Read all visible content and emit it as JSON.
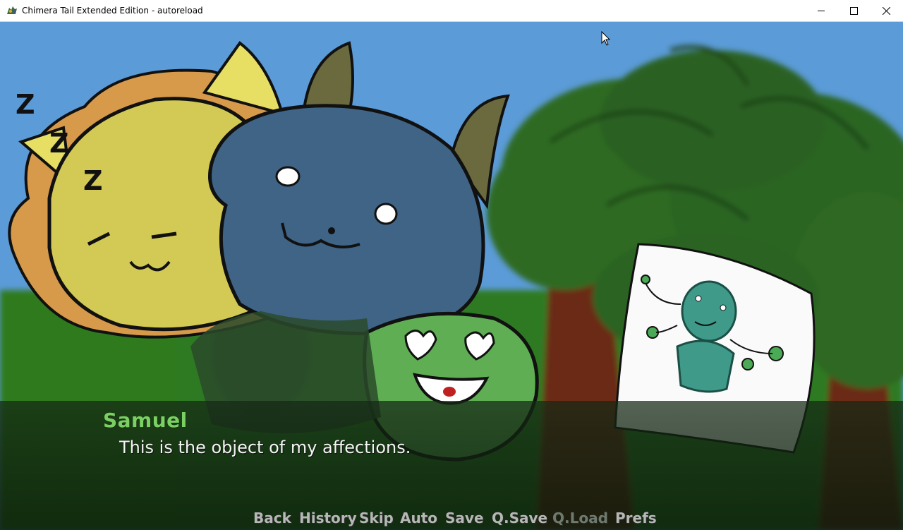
{
  "window": {
    "title": "Chimera Tail Extended Edition - autoreload",
    "minimize_icon": "minimize-icon",
    "maximize_icon": "maximize-icon",
    "close_icon": "close-icon"
  },
  "scene": {
    "sleep_letters": [
      "Z",
      "Z",
      "Z"
    ],
    "characters": [
      "yellow-dragon",
      "blue-horned-creature",
      "green-blob"
    ],
    "held_drawing": "drawing-of-teal-creature"
  },
  "dialogue": {
    "speaker": "Samuel",
    "text": "This is the object of my affections.",
    "speaker_color": "#7ad063"
  },
  "quick_menu": {
    "back": "Back",
    "history": "History",
    "skip": "Skip",
    "auto": "Auto",
    "save": "Save",
    "qsave": "Q.Save",
    "qload": "Q.Load",
    "prefs": "Prefs"
  }
}
